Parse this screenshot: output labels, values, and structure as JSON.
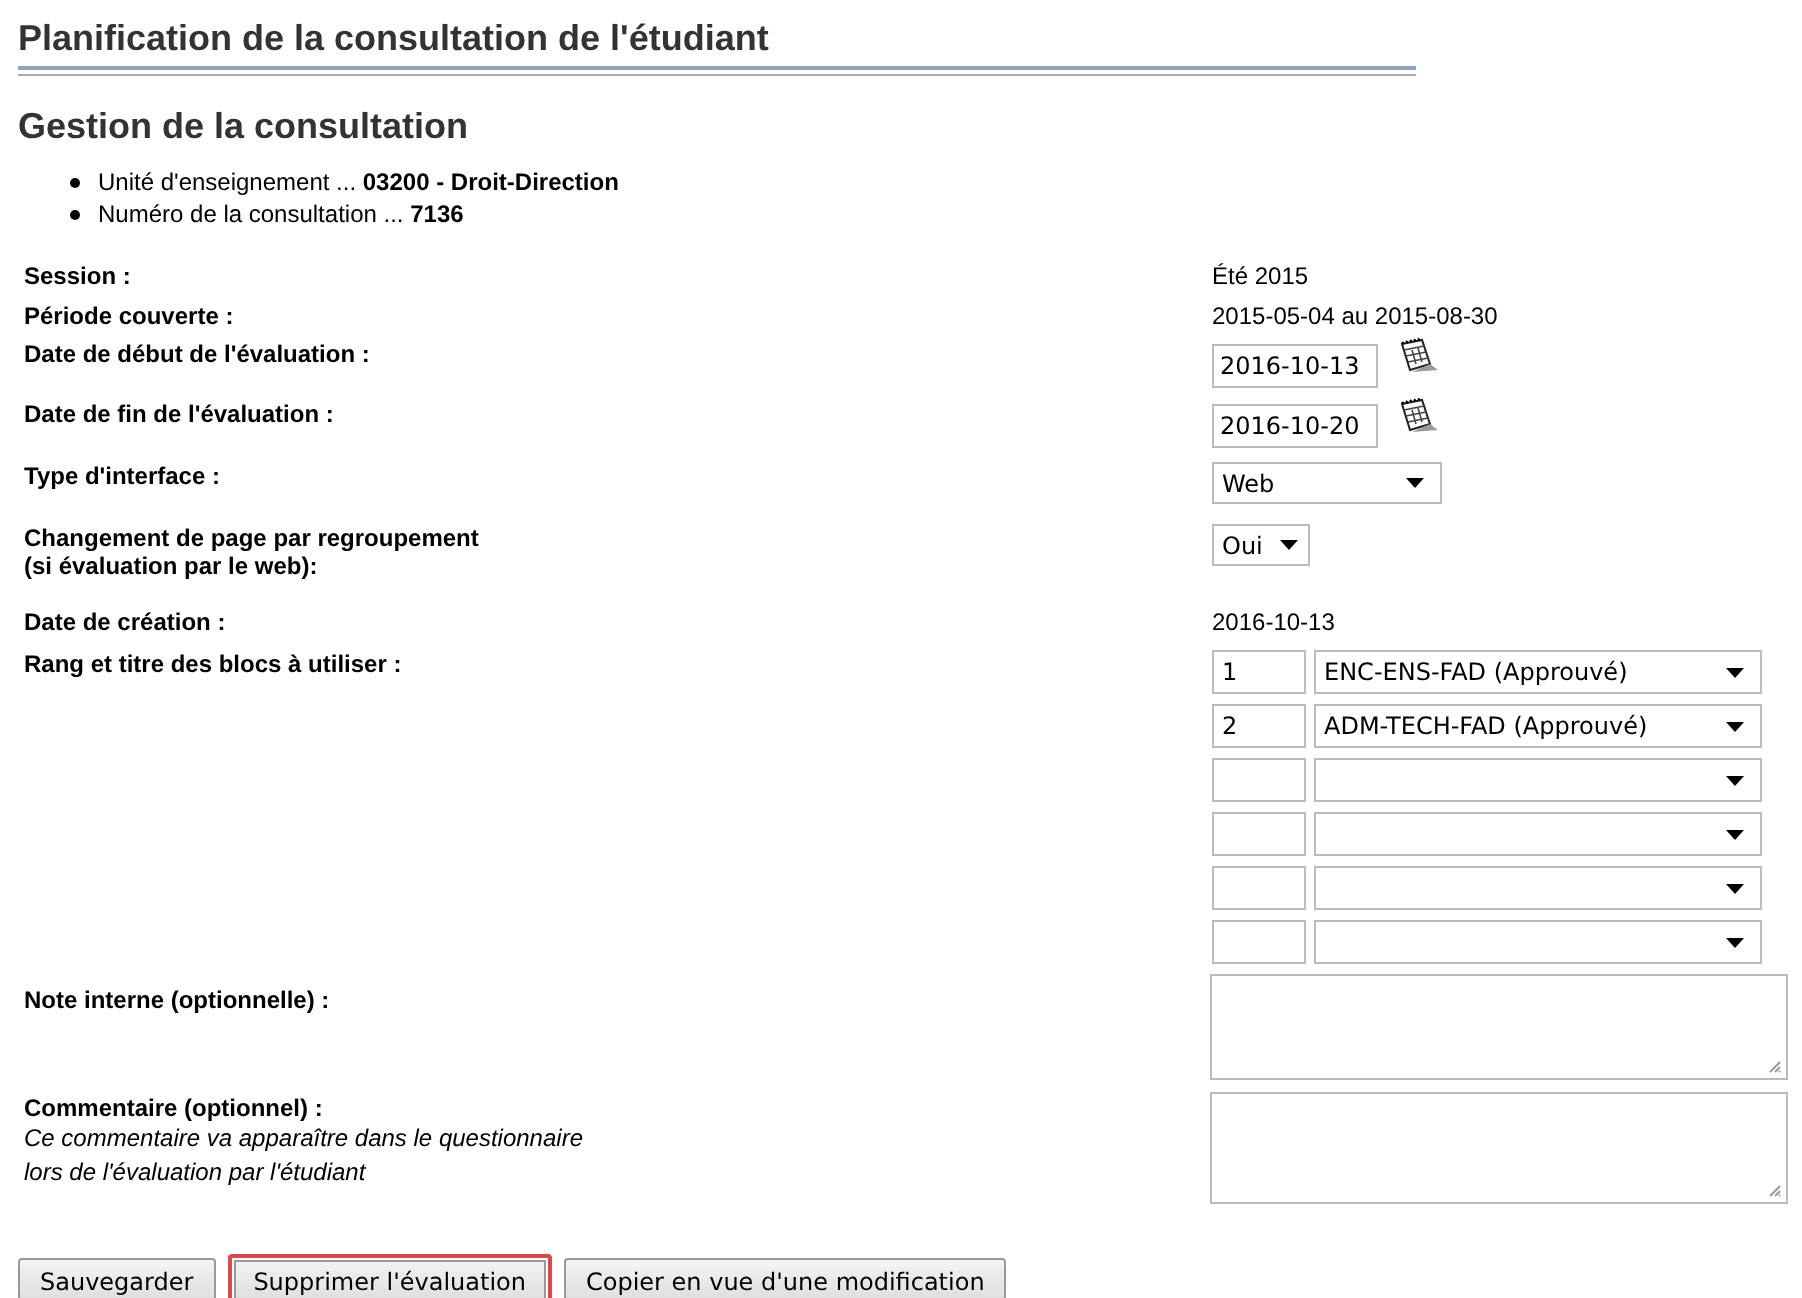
{
  "page_title": "Planification de la consultation de l'étudiant",
  "section_title": "Gestion de la consultation",
  "info": [
    {
      "label": "Unité d'enseignement ...",
      "value": "03200 - Droit-Direction"
    },
    {
      "label": "Numéro de la consultation ...",
      "value": "7136"
    }
  ],
  "fields": [
    {
      "kind": "text",
      "label": "Session :",
      "value": "Été 2015"
    },
    {
      "kind": "text",
      "label": "Période couverte :",
      "value": "2015-05-04 au 2015-08-30"
    },
    {
      "kind": "date",
      "label": "Date de début de l'évaluation :",
      "value": "2016-10-13"
    },
    {
      "kind": "date",
      "label": "Date de fin de l'évaluation :",
      "value": "2016-10-20"
    },
    {
      "kind": "select",
      "label": "Type d'interface :",
      "value": "Web"
    },
    {
      "kind": "toggle",
      "label": "Changement de page par regroupement",
      "label_note": "(si évaluation par le web):",
      "value": "Oui"
    },
    {
      "kind": "text",
      "label": "Date de création :",
      "value": "2016-10-13"
    },
    {
      "kind": "blocks",
      "label": "Rang et titre des blocs à utiliser :",
      "blocks": [
        {
          "kind": "filled",
          "rank": "1",
          "title": "ENC-ENS-FAD (Approuvé)"
        },
        {
          "kind": "filled",
          "rank": "2",
          "title": "ADM-TECH-FAD (Approuvé)"
        },
        {
          "kind": "empty"
        },
        {
          "kind": "empty"
        },
        {
          "kind": "empty"
        },
        {
          "kind": "empty"
        }
      ]
    },
    {
      "kind": "textarea",
      "label": "Note interne (optionnelle) :"
    },
    {
      "kind": "textarea",
      "label": "Commentaire (optionnel) :",
      "note_lines": [
        "Ce commentaire va apparaître dans le questionnaire",
        "lors de l'évaluation par l'étudiant"
      ]
    }
  ],
  "buttons": [
    {
      "label": "Sauvegarder",
      "highlighted": false
    },
    {
      "label": "Supprimer l'évaluation",
      "highlighted": true
    },
    {
      "label": "Copier en vue d'une modification",
      "highlighted": false
    }
  ]
}
